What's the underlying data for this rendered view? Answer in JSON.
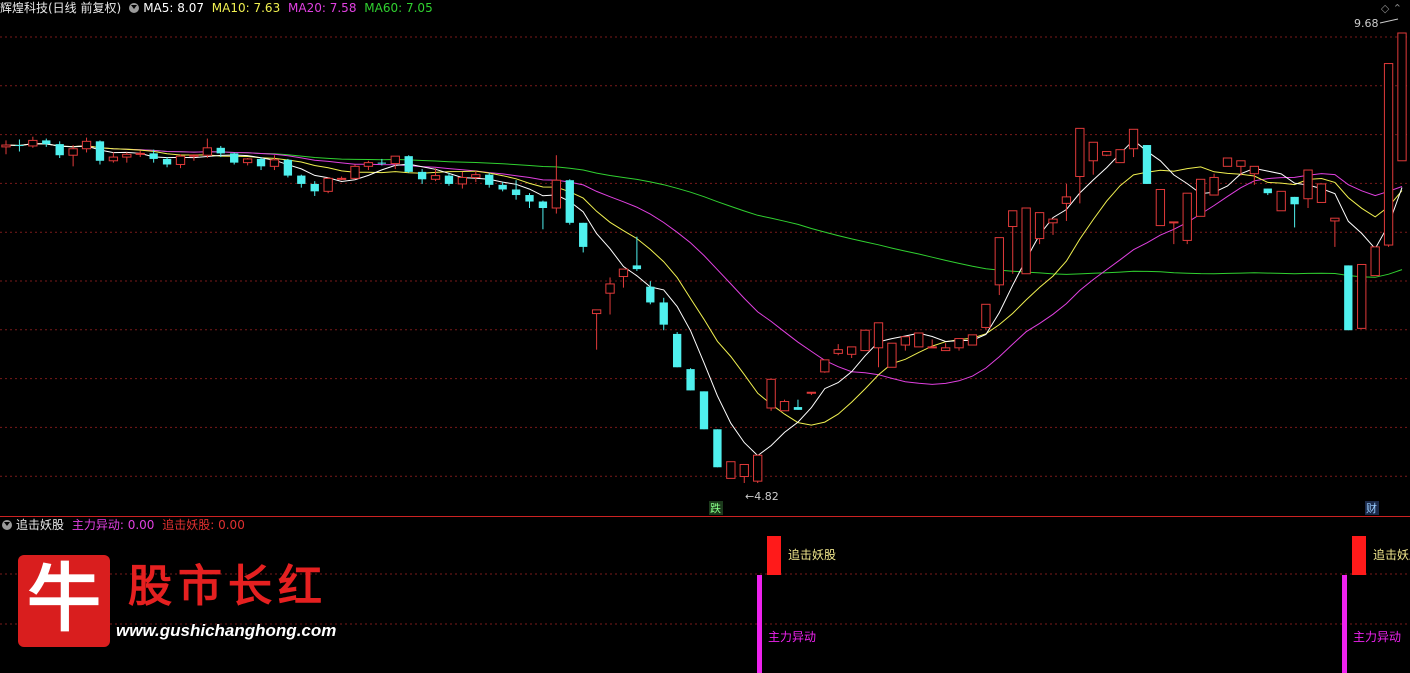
{
  "main_header": {
    "stock_name": "辉煌科技(日线 前复权)",
    "ma5": "MA5: 8.07",
    "ma10": "MA10: 7.63",
    "ma20": "MA20: 7.58",
    "ma60": "MA60: 7.05"
  },
  "sub_header": {
    "indicator_name": "追击妖股",
    "main_force": "主力异动: 0.00",
    "chase": "追击妖股: 0.00"
  },
  "annotations": {
    "high_price": "9.68",
    "low_price": "4.82",
    "low_marker": "跌",
    "fin_marker": "财"
  },
  "signals": {
    "chase_label": "追击妖股",
    "main_force_label": "主力异动"
  },
  "watermark": {
    "logo_char": "牛",
    "title": "股市长红",
    "url": "www.gushichanghong.com"
  },
  "colors": {
    "up": "#e03a3a",
    "down": "#4ff0ee",
    "ma5": "#ffffff",
    "ma10": "#f0f050",
    "ma20": "#e040e0",
    "ma60": "#30d030",
    "grid": "#7a1a1a"
  },
  "chart_data": {
    "type": "candlestick",
    "title": "辉煌科技(日线 前复权)",
    "candles": [
      [
        8.45,
        8.52,
        8.37,
        8.47
      ],
      [
        8.47,
        8.53,
        8.4,
        8.46
      ],
      [
        8.46,
        8.56,
        8.44,
        8.52
      ],
      [
        8.52,
        8.54,
        8.45,
        8.48
      ],
      [
        8.48,
        8.51,
        8.33,
        8.36
      ],
      [
        8.36,
        8.47,
        8.24,
        8.43
      ],
      [
        8.43,
        8.55,
        8.39,
        8.51
      ],
      [
        8.51,
        8.52,
        8.26,
        8.3
      ],
      [
        8.3,
        8.39,
        8.28,
        8.34
      ],
      [
        8.34,
        8.39,
        8.28,
        8.37
      ],
      [
        8.37,
        8.41,
        8.34,
        8.38
      ],
      [
        8.38,
        8.42,
        8.28,
        8.32
      ],
      [
        8.32,
        8.34,
        8.23,
        8.26
      ],
      [
        8.26,
        8.37,
        8.22,
        8.35
      ],
      [
        8.35,
        8.37,
        8.3,
        8.36
      ],
      [
        8.36,
        8.54,
        8.33,
        8.44
      ],
      [
        8.44,
        8.46,
        8.34,
        8.38
      ],
      [
        8.38,
        8.39,
        8.26,
        8.28
      ],
      [
        8.28,
        8.33,
        8.25,
        8.32
      ],
      [
        8.32,
        8.34,
        8.2,
        8.24
      ],
      [
        8.24,
        8.36,
        8.2,
        8.31
      ],
      [
        8.31,
        8.32,
        8.12,
        8.14
      ],
      [
        8.14,
        8.15,
        8.01,
        8.05
      ],
      [
        8.05,
        8.08,
        7.92,
        7.97
      ],
      [
        7.97,
        8.12,
        7.95,
        8.11
      ],
      [
        8.11,
        8.13,
        8.09,
        8.11
      ],
      [
        8.11,
        8.26,
        8.1,
        8.24
      ],
      [
        8.24,
        8.3,
        8.2,
        8.28
      ],
      [
        8.28,
        8.32,
        8.25,
        8.27
      ],
      [
        8.27,
        8.33,
        8.21,
        8.35
      ],
      [
        8.35,
        8.36,
        8.17,
        8.18
      ],
      [
        8.18,
        8.21,
        8.05,
        8.1
      ],
      [
        8.1,
        8.22,
        8.08,
        8.14
      ],
      [
        8.14,
        8.17,
        8.03,
        8.05
      ],
      [
        8.05,
        8.18,
        8.0,
        8.12
      ],
      [
        8.12,
        8.19,
        8.07,
        8.15
      ],
      [
        8.15,
        8.17,
        8.01,
        8.04
      ],
      [
        8.04,
        8.07,
        7.97,
        7.99
      ],
      [
        7.99,
        8.09,
        7.88,
        7.93
      ],
      [
        7.93,
        7.95,
        7.79,
        7.86
      ],
      [
        7.86,
        7.87,
        7.56,
        7.79
      ],
      [
        7.79,
        8.36,
        7.73,
        8.09
      ],
      [
        8.09,
        8.1,
        7.61,
        7.63
      ],
      [
        7.63,
        7.63,
        7.31,
        7.37
      ],
      [
        6.65,
        6.68,
        6.26,
        6.69
      ],
      [
        6.87,
        7.04,
        6.64,
        6.97
      ],
      [
        7.05,
        7.13,
        6.93,
        7.13
      ],
      [
        7.17,
        7.48,
        7.11,
        7.13
      ],
      [
        6.94,
        7.0,
        6.75,
        6.77
      ],
      [
        6.77,
        6.82,
        6.47,
        6.53
      ],
      [
        6.43,
        6.45,
        6.37,
        6.07
      ],
      [
        6.05,
        6.06,
        6.03,
        5.82
      ],
      [
        5.81,
        5.79,
        5.6,
        5.4
      ],
      [
        5.4,
        5.39,
        4.99,
        4.99
      ],
      [
        4.87,
        4.87,
        5.05,
        5.05
      ],
      [
        4.89,
        4.82,
        5.02,
        5.02
      ],
      [
        4.84,
        4.82,
        5.12,
        5.12
      ],
      [
        5.63,
        5.6,
        5.62,
        5.94
      ],
      [
        5.6,
        5.7,
        5.72,
        5.7
      ],
      [
        5.64,
        5.7,
        5.72,
        5.61
      ],
      [
        5.8,
        5.77,
        5.8,
        5.8
      ],
      [
        6.02,
        6.08,
        6.01,
        6.15
      ],
      [
        6.22,
        6.32,
        6.2,
        6.26
      ],
      [
        6.21,
        6.21,
        6.17,
        6.29
      ],
      [
        6.25,
        6.4,
        6.26,
        6.47
      ],
      [
        6.28,
        6.28,
        6.07,
        6.55
      ],
      [
        6.07,
        6.28,
        6.3,
        6.33
      ],
      [
        6.31,
        6.25,
        6.33,
        6.4
      ],
      [
        6.29,
        6.36,
        6.37,
        6.44
      ],
      [
        6.29,
        6.37,
        6.34,
        6.29
      ],
      [
        6.25,
        6.31,
        6.33,
        6.28
      ],
      [
        6.28,
        6.28,
        6.25,
        6.38
      ],
      [
        6.31,
        6.33,
        6.32,
        6.42
      ],
      [
        6.5,
        6.48,
        6.63,
        6.75
      ],
      [
        6.96,
        6.98,
        6.85,
        7.47
      ],
      [
        7.59,
        7.59,
        7.08,
        7.76
      ],
      [
        7.08,
        7.31,
        7.44,
        7.79
      ],
      [
        7.46,
        7.4,
        7.53,
        7.74
      ],
      [
        7.63,
        7.5,
        7.57,
        7.67
      ],
      [
        7.84,
        8.05,
        7.65,
        7.91
      ],
      [
        8.13,
        8.09,
        7.84,
        8.65
      ],
      [
        8.3,
        8.45,
        8.15,
        8.5
      ],
      [
        8.36,
        8.35,
        8.38,
        8.4
      ],
      [
        8.28,
        8.38,
        8.39,
        8.42
      ],
      [
        8.43,
        8.47,
        8.34,
        8.64
      ],
      [
        8.47,
        8.1,
        8.1,
        8.05
      ],
      [
        7.6,
        7.68,
        7.79,
        7.99
      ],
      [
        7.64,
        7.4,
        7.64,
        7.64
      ],
      [
        7.44,
        7.4,
        7.67,
        7.95
      ],
      [
        7.7,
        7.88,
        7.95,
        8.1
      ],
      [
        7.93,
        8.05,
        8.16,
        8.12
      ],
      [
        8.24,
        8.27,
        8.3,
        8.33
      ],
      [
        8.24,
        8.2,
        8.14,
        8.3
      ],
      [
        8.16,
        8.04,
        8.05,
        8.24
      ],
      [
        8.0,
        7.93,
        7.96,
        7.95
      ],
      [
        7.76,
        7.88,
        7.97,
        7.97
      ],
      [
        7.91,
        7.58,
        7.85,
        7.83
      ],
      [
        7.89,
        8.02,
        7.79,
        8.2
      ],
      [
        7.85,
        8.03,
        7.92,
        8.05
      ],
      [
        7.65,
        7.41,
        7.37,
        7.68
      ],
      [
        7.17,
        6.47,
        7.17,
        6.47
      ],
      [
        6.49,
        6.71,
        7.18,
        7.18
      ],
      [
        7.06,
        7.08,
        7.32,
        7.37
      ],
      [
        7.39,
        7.37,
        8.28,
        9.35
      ],
      [
        8.3,
        8.88,
        8.7,
        9.68
      ]
    ],
    "ma_values": {
      "MA5": 8.07,
      "MA10": 7.63,
      "MA20": 7.58,
      "MA60": 7.05
    },
    "high": 9.68,
    "low": 4.82
  }
}
